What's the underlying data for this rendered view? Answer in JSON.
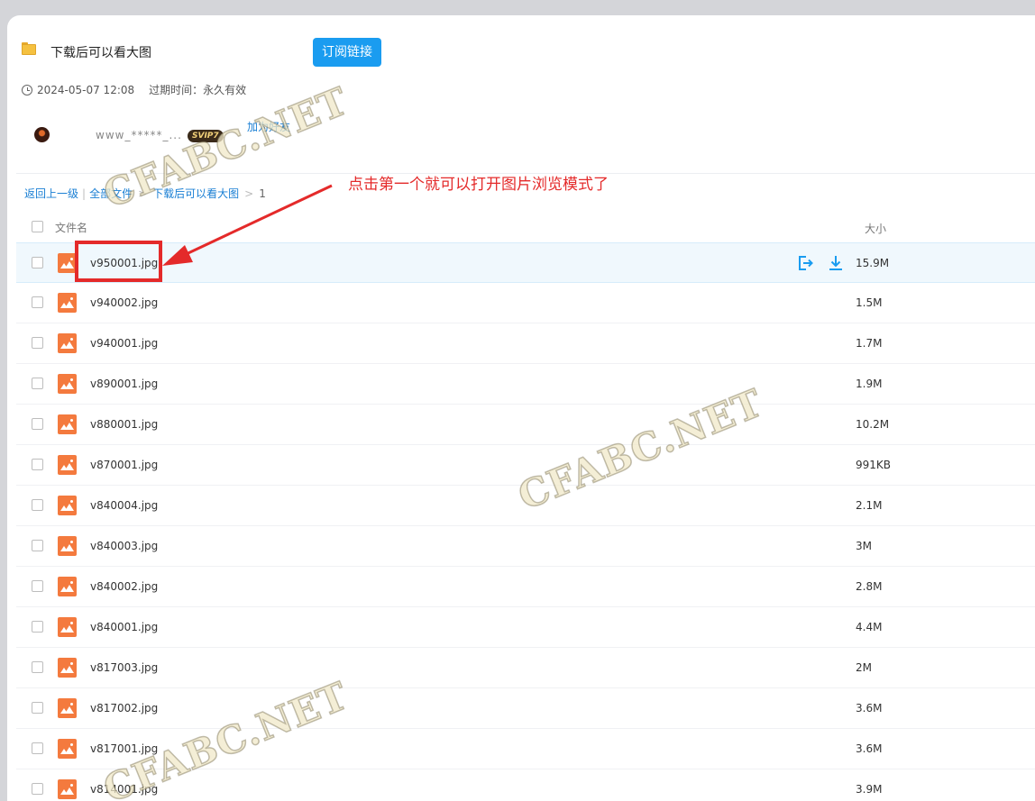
{
  "header": {
    "folder_title": "下载后可以看大图",
    "subscribe_label": "订阅链接",
    "timestamp": "2024-05-07 12:08",
    "expire_label": "过期时间：永久有效"
  },
  "user": {
    "name": "www_*****_...",
    "badge": "SVIP7",
    "add_friend": "加为好友"
  },
  "breadcrumb": {
    "back": "返回上一级",
    "all_files": "全部文件",
    "folder": "下载后可以看大图",
    "current": "1"
  },
  "list": {
    "col_name": "文件名",
    "col_size": "大小",
    "files": [
      {
        "name": "v950001.jpg",
        "size": "15.9M"
      },
      {
        "name": "v940002.jpg",
        "size": "1.5M"
      },
      {
        "name": "v940001.jpg",
        "size": "1.7M"
      },
      {
        "name": "v890001.jpg",
        "size": "1.9M"
      },
      {
        "name": "v880001.jpg",
        "size": "10.2M"
      },
      {
        "name": "v870001.jpg",
        "size": "991KB"
      },
      {
        "name": "v840004.jpg",
        "size": "2.1M"
      },
      {
        "name": "v840003.jpg",
        "size": "3M"
      },
      {
        "name": "v840002.jpg",
        "size": "2.8M"
      },
      {
        "name": "v840001.jpg",
        "size": "4.4M"
      },
      {
        "name": "v817003.jpg",
        "size": "2M"
      },
      {
        "name": "v817002.jpg",
        "size": "3.6M"
      },
      {
        "name": "v817001.jpg",
        "size": "3.6M"
      },
      {
        "name": "v814001.jpg",
        "size": "3.9M"
      }
    ]
  },
  "annotation": {
    "text": "点击第一个就可以打开图片浏览模式了"
  },
  "watermark": "CFABC.NET",
  "colors": {
    "accent": "#1a9cf0",
    "annotation_red": "#e42a2a",
    "image_icon": "#f47a3e"
  }
}
